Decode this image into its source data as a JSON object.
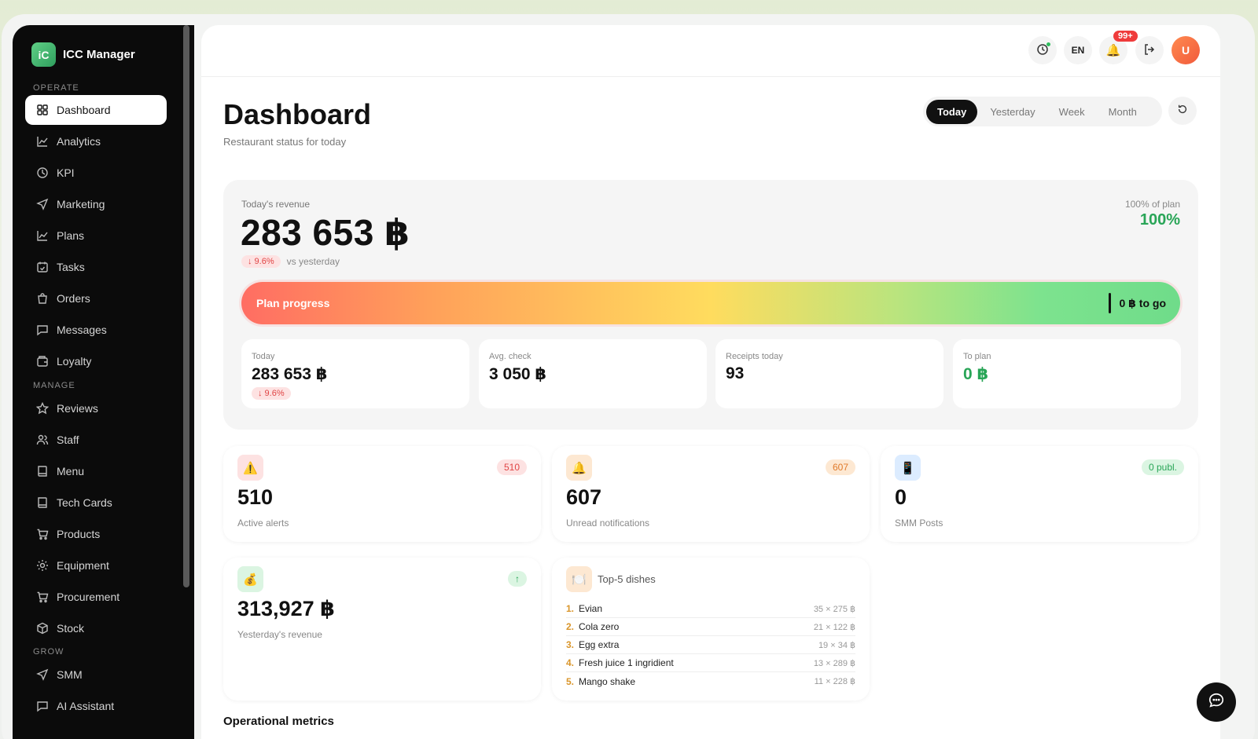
{
  "app": {
    "name": "ICC Manager",
    "logo_text": "iC"
  },
  "sidebar": {
    "sections": {
      "operate": "OPERATE",
      "manage": "MANAGE",
      "grow": "GROW"
    },
    "items": [
      {
        "label": "Dashboard",
        "icon": "grid-icon"
      },
      {
        "label": "Analytics",
        "icon": "chart-line-icon"
      },
      {
        "label": "KPI",
        "icon": "clock-icon"
      },
      {
        "label": "Marketing",
        "icon": "send-icon"
      },
      {
        "label": "Plans",
        "icon": "chart-line-icon"
      },
      {
        "label": "Tasks",
        "icon": "calendar-check-icon"
      },
      {
        "label": "Orders",
        "icon": "bag-icon"
      },
      {
        "label": "Messages",
        "icon": "message-icon"
      },
      {
        "label": "Loyalty",
        "icon": "wallet-icon"
      },
      {
        "label": "Reviews",
        "icon": "star-icon"
      },
      {
        "label": "Staff",
        "icon": "users-icon"
      },
      {
        "label": "Menu",
        "icon": "book-icon"
      },
      {
        "label": "Tech Cards",
        "icon": "book-icon"
      },
      {
        "label": "Products",
        "icon": "cart-icon"
      },
      {
        "label": "Equipment",
        "icon": "sun-icon"
      },
      {
        "label": "Procurement",
        "icon": "cart-icon"
      },
      {
        "label": "Stock",
        "icon": "box-icon"
      },
      {
        "label": "SMM",
        "icon": "send-icon"
      },
      {
        "label": "AI Assistant",
        "icon": "message-icon"
      }
    ]
  },
  "topbar": {
    "language": "EN",
    "notifications_badge": "99+",
    "avatar_initial": "U"
  },
  "header": {
    "title": "Dashboard",
    "subtitle": "Restaurant status for today",
    "periods": [
      "Today",
      "Yesterday",
      "Week",
      "Month"
    ],
    "active_period": "Today"
  },
  "revenue": {
    "label": "Today's revenue",
    "value": "283 653 ฿",
    "delta": "↓ 9.6%",
    "vs": "vs yesterday",
    "plan_label": "100% of plan",
    "plan_pct": "100%",
    "progress_label": "Plan progress",
    "progress_fraction": 1.0,
    "to_go": "0 ฿ to go"
  },
  "stats": [
    {
      "label": "Today",
      "value": "283 653 ฿",
      "delta": "↓ 9.6%"
    },
    {
      "label": "Avg. check",
      "value": "3 050 ฿"
    },
    {
      "label": "Receipts today",
      "value": "93"
    },
    {
      "label": "To plan",
      "value": "0 ฿"
    }
  ],
  "cards": {
    "alerts": {
      "value": "510",
      "label": "Active alerts",
      "badge": "510",
      "icon": "⚠️"
    },
    "notifications": {
      "value": "607",
      "label": "Unread notifications",
      "badge": "607",
      "icon": "🔔"
    },
    "smm": {
      "value": "0",
      "label": "SMM Posts",
      "badge": "0 publ.",
      "icon": "📱"
    },
    "yesterday": {
      "value": "313,927 ฿",
      "label": "Yesterday's revenue",
      "badge": "↑",
      "icon": "💰"
    }
  },
  "top_dishes": {
    "title": "Top-5 dishes",
    "icon": "🍽️",
    "items": [
      {
        "n": "1.",
        "name": "Evian",
        "qty": "35 × 275 ฿"
      },
      {
        "n": "2.",
        "name": "Cola zero",
        "qty": "21 × 122 ฿"
      },
      {
        "n": "3.",
        "name": "Egg extra",
        "qty": "19 × 34 ฿"
      },
      {
        "n": "4.",
        "name": "Fresh juice 1 ingridient",
        "qty": "13 × 289 ฿"
      },
      {
        "n": "5.",
        "name": "Mango shake",
        "qty": "11 × 228 ฿"
      }
    ]
  },
  "operational_title": "Operational metrics",
  "colors": {
    "accent_green": "#29a557",
    "danger": "#e04545",
    "sidebar_bg": "#0b0b0b"
  }
}
